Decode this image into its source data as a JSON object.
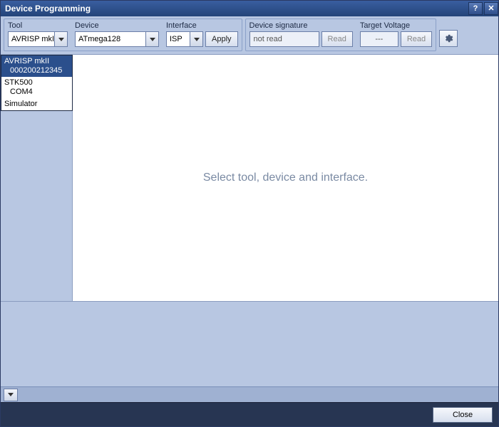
{
  "window": {
    "title": "Device Programming"
  },
  "toolbar": {
    "tool": {
      "label": "Tool",
      "value": "AVRISP mkII",
      "options": [
        {
          "name": "AVRISP mkII",
          "detail": "000200212345",
          "selected": true
        },
        {
          "name": "STK500",
          "detail": "COM4",
          "selected": false
        },
        {
          "name": "Simulator",
          "detail": "",
          "selected": false
        }
      ]
    },
    "device": {
      "label": "Device",
      "value": "ATmega128"
    },
    "interface": {
      "label": "Interface",
      "value": "ISP"
    },
    "apply": "Apply",
    "signature": {
      "label": "Device signature",
      "value": "not read",
      "read": "Read"
    },
    "voltage": {
      "label": "Target Voltage",
      "value": "---",
      "read": "Read"
    }
  },
  "main": {
    "placeholder": "Select tool, device and interface."
  },
  "footer": {
    "close": "Close"
  }
}
